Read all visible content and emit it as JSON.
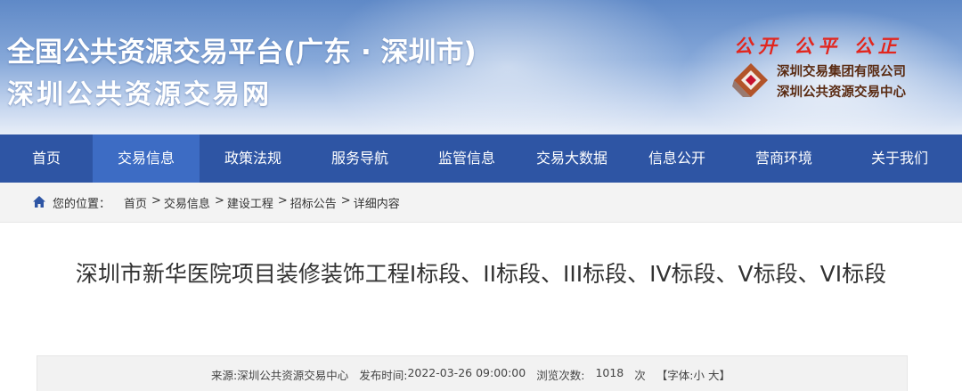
{
  "header": {
    "title_line1": "全国公共资源交易平台(广东 · 深圳市)",
    "title_line2": "深圳公共资源交易网",
    "slogan": "公开 公平 公正",
    "org_line1": "深圳交易集团有限公司",
    "org_line2": "深圳公共资源交易中心",
    "logo_icon": "shenzhen-exchange-group-logo",
    "colors": {
      "slogan": "#e2261e",
      "org_text": "#5a2b12",
      "banner_top": "#5f89c7"
    }
  },
  "nav": {
    "items": [
      {
        "label": "首页"
      },
      {
        "label": "交易信息"
      },
      {
        "label": "政策法规"
      },
      {
        "label": "服务导航"
      },
      {
        "label": "监管信息"
      },
      {
        "label": "交易大数据"
      },
      {
        "label": "信息公开"
      },
      {
        "label": "营商环境"
      },
      {
        "label": "关于我们"
      }
    ],
    "active": "交易信息",
    "colors": {
      "bar": "#2e55a4",
      "active": "#3d6cc4"
    }
  },
  "breadcrumb": {
    "icon": "home-icon",
    "label": "您的位置：",
    "items": [
      "首页",
      "交易信息",
      "建设工程",
      "招标公告",
      "详细内容"
    ],
    "separator": ">"
  },
  "article": {
    "title": "深圳市新华医院项目装修装饰工程I标段、II标段、III标段、IV标段、V标段、VI标段"
  },
  "meta": {
    "source_label": "来源:",
    "source_value": "深圳公共资源交易中心",
    "published_label": "发布时间:",
    "published_value": "2022-03-26 09:00:00",
    "views_label": "浏览次数:",
    "views_value": "1018",
    "views_unit": "次",
    "font_label": "【字体:",
    "font_small": "小",
    "font_large": "大",
    "font_close": "】"
  }
}
